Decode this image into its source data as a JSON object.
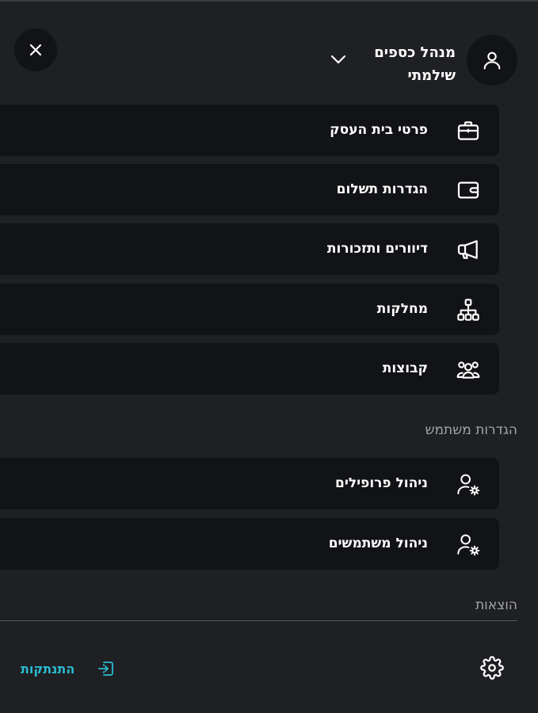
{
  "header": {
    "user_name_line1": "מנהל כספים",
    "user_name_line2": "שילמתי"
  },
  "menu": {
    "items": [
      {
        "label": "פרטי בית העסק",
        "icon": "briefcase-icon"
      },
      {
        "label": "הגדרות תשלום",
        "icon": "wallet-icon"
      },
      {
        "label": "דיוורים ותזכורות",
        "icon": "megaphone-icon"
      },
      {
        "label": "מחלקות",
        "icon": "sitemap-icon"
      },
      {
        "label": "קבוצות",
        "icon": "users-group-icon"
      }
    ]
  },
  "user_settings": {
    "title": "הגדרות משתמש",
    "items": [
      {
        "label": "ניהול פרופילים",
        "icon": "user-gear-icon"
      },
      {
        "label": "ניהול משתמשים",
        "icon": "user-gear-icon"
      }
    ]
  },
  "expenses": {
    "title": "הוצאות"
  },
  "footer": {
    "logout_label": "התנתקות"
  },
  "colors": {
    "background": "#1f2023",
    "item_background": "#121316",
    "accent": "#2bbbd1",
    "muted_text": "#a3a4a7"
  }
}
